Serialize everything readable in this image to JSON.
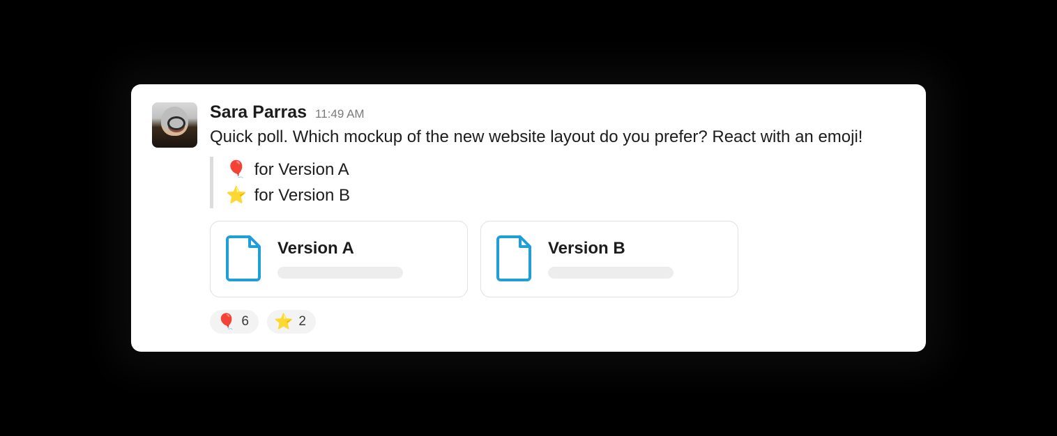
{
  "message": {
    "author": "Sara Parras",
    "timestamp": "11:49 AM",
    "body": "Quick poll. Which mockup of the new website layout do you prefer? React with an emoji!",
    "options": [
      {
        "emoji": "🎈",
        "label": "for Version A"
      },
      {
        "emoji": "⭐",
        "label": "for Version B"
      }
    ],
    "attachments": [
      {
        "title": "Version A"
      },
      {
        "title": "Version B"
      }
    ],
    "reactions": [
      {
        "emoji": "🎈",
        "count": "6"
      },
      {
        "emoji": "⭐",
        "count": "2"
      }
    ]
  }
}
